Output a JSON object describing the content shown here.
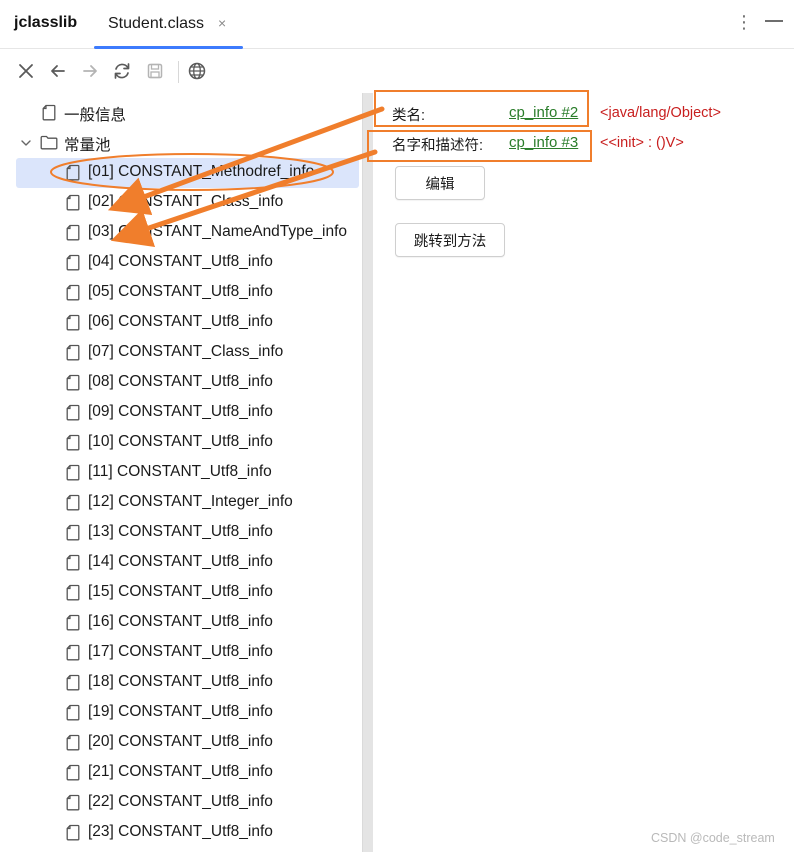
{
  "header": {
    "app_title": "jclasslib",
    "tab_label": "Student.class",
    "tab_close": "×",
    "kebab": "⋮"
  },
  "toolbar": {
    "icons": [
      "close-icon",
      "back-arrow-icon",
      "forward-arrow-icon",
      "refresh-icon",
      "save-icon",
      "globe-icon"
    ]
  },
  "tree": {
    "general_info": "一般信息",
    "constant_pool": "常量池",
    "items": [
      "[01] CONSTANT_Methodref_info",
      "[02] CONSTANT_Class_info",
      "[03] CONSTANT_NameAndType_info",
      "[04] CONSTANT_Utf8_info",
      "[05] CONSTANT_Utf8_info",
      "[06] CONSTANT_Utf8_info",
      "[07] CONSTANT_Class_info",
      "[08] CONSTANT_Utf8_info",
      "[09] CONSTANT_Utf8_info",
      "[10] CONSTANT_Utf8_info",
      "[11] CONSTANT_Utf8_info",
      "[12] CONSTANT_Integer_info",
      "[13] CONSTANT_Utf8_info",
      "[14] CONSTANT_Utf8_info",
      "[15] CONSTANT_Utf8_info",
      "[16] CONSTANT_Utf8_info",
      "[17] CONSTANT_Utf8_info",
      "[18] CONSTANT_Utf8_info",
      "[19] CONSTANT_Utf8_info",
      "[20] CONSTANT_Utf8_info",
      "[21] CONSTANT_Utf8_info",
      "[22] CONSTANT_Utf8_info",
      "[23] CONSTANT_Utf8_info"
    ],
    "selected_index": 0
  },
  "details": {
    "class_name_label": "类名:",
    "class_name_link": "cp_info #2",
    "class_name_value": "<java/lang/Object>",
    "name_type_label": "名字和描述符:",
    "name_type_link": "cp_info #3",
    "name_type_value": "<<init> : ()V>",
    "edit_button": "编辑",
    "jump_button": "跳转到方法"
  },
  "colors": {
    "accent": "#3d7bfd",
    "annotation": "#f07e2c",
    "link": "#2a7d2a",
    "value": "#c81e1e",
    "selection": "#dbe5fb"
  },
  "watermark": "CSDN @code_stream"
}
